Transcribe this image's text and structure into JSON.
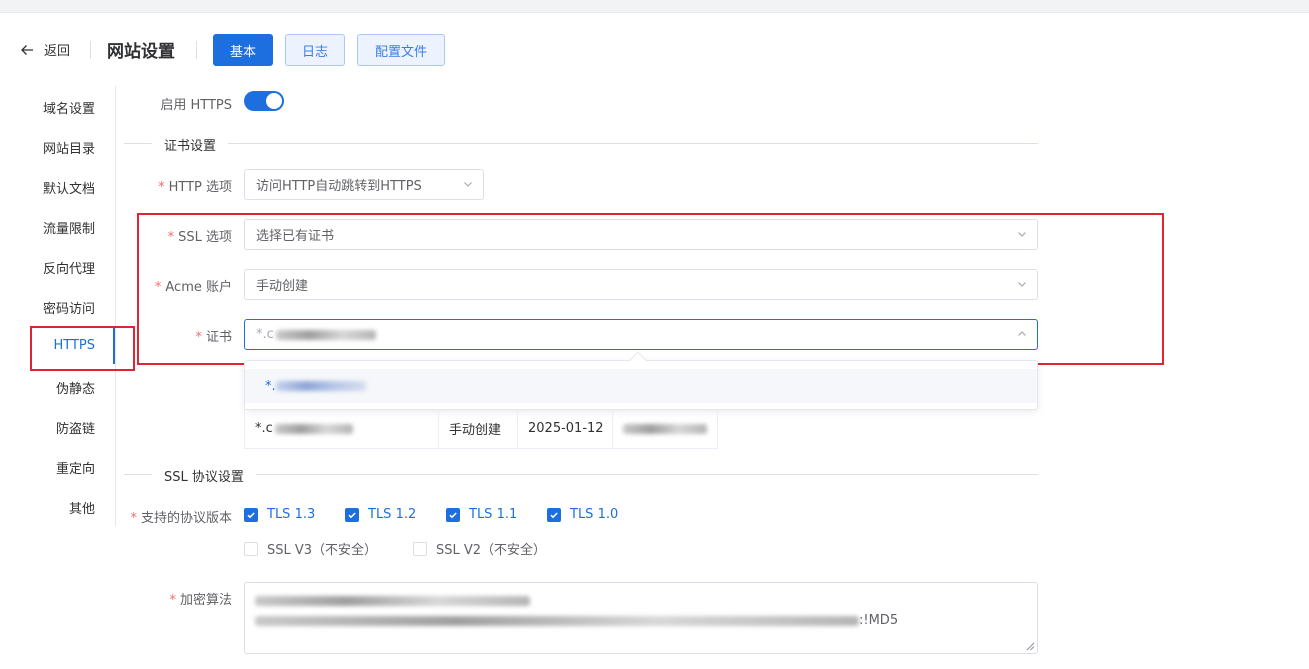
{
  "header": {
    "back_label": "返回",
    "title": "网站设置",
    "tabs": [
      {
        "label": "基本",
        "active": true
      },
      {
        "label": "日志",
        "active": false
      },
      {
        "label": "配置文件",
        "active": false
      }
    ]
  },
  "sidebar": {
    "items": [
      {
        "label": "域名设置"
      },
      {
        "label": "网站目录"
      },
      {
        "label": "默认文档"
      },
      {
        "label": "流量限制"
      },
      {
        "label": "反向代理"
      },
      {
        "label": "密码访问"
      },
      {
        "label": "HTTPS",
        "active": true
      },
      {
        "label": "伪静态"
      },
      {
        "label": "防盗链"
      },
      {
        "label": "重定向"
      },
      {
        "label": "其他"
      }
    ]
  },
  "form": {
    "enable_https_label": "启用 HTTPS",
    "enable_https_on": true,
    "cert_section_title": "证书设置",
    "http_option": {
      "label": "HTTP 选项",
      "value": "访问HTTP自动跳转到HTTPS"
    },
    "ssl_option": {
      "label": "SSL 选项",
      "value": "选择已有证书"
    },
    "acme_account": {
      "label": "Acme 账户",
      "value": "手动创建"
    },
    "certificate": {
      "label": "证书",
      "value_prefix": "*.c",
      "dropdown_prefix": "*."
    },
    "cert_table": {
      "domain_prefix": "*.c",
      "provider": "手动创建",
      "expire_date": "2025-01-12"
    },
    "ssl_section_title": "SSL 协议设置",
    "protocols_label": "支持的协议版本",
    "protocols": [
      {
        "label": "TLS 1.3",
        "checked": true
      },
      {
        "label": "TLS 1.2",
        "checked": true
      },
      {
        "label": "TLS 1.1",
        "checked": true
      },
      {
        "label": "TLS 1.0",
        "checked": true
      },
      {
        "label": "SSL V3（不安全）",
        "checked": false
      },
      {
        "label": "SSL V2（不安全）",
        "checked": false
      }
    ],
    "cipher_label": "加密算法",
    "cipher_suffix": ":!MD5"
  },
  "colors": {
    "primary": "#1d6fe0",
    "highlight_box": "#e02431",
    "required": "#f56c6c"
  }
}
